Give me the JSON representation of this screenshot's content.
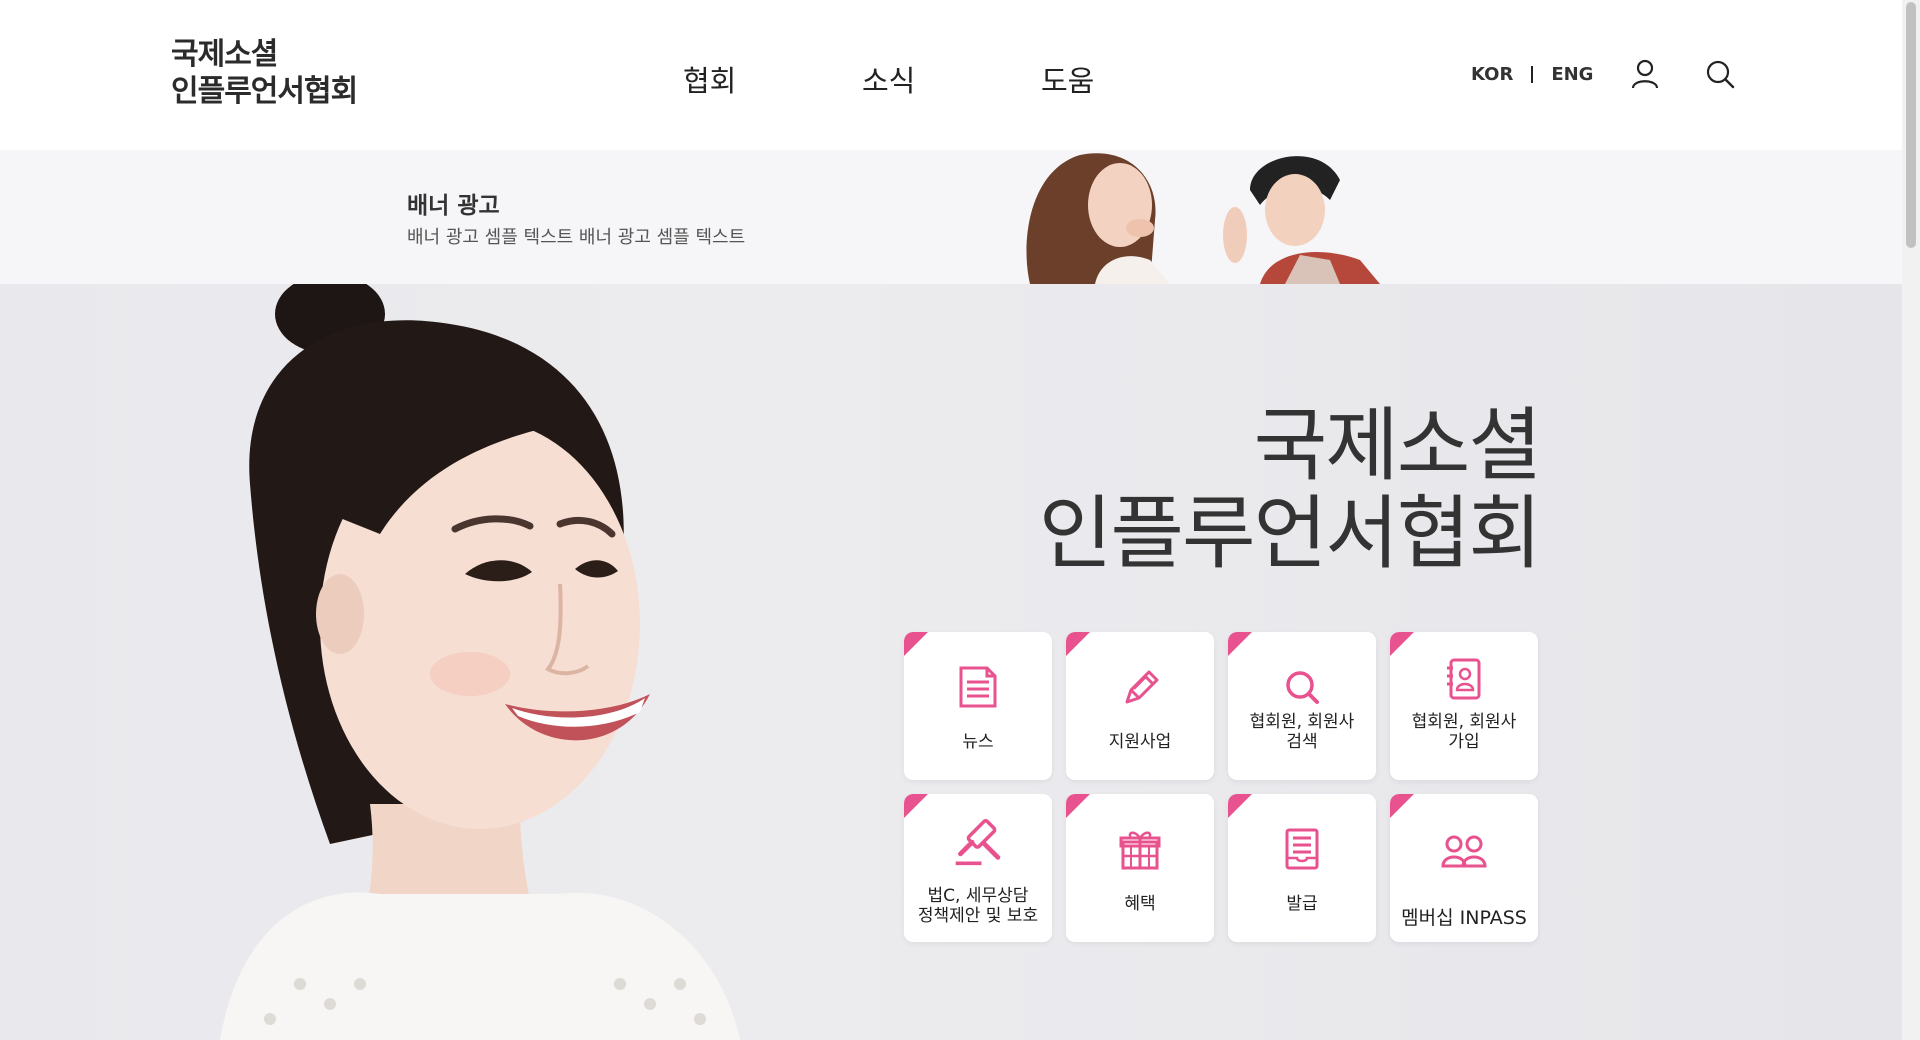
{
  "header": {
    "logo_line1": "국제소셜",
    "logo_line2": "인플루언서협회",
    "nav": [
      {
        "label": "협회"
      },
      {
        "label": "소식"
      },
      {
        "label": "도움"
      }
    ],
    "lang_kor": "KOR",
    "lang_eng": "ENG"
  },
  "banner": {
    "title": "배너 광고",
    "text": "배너 광고 셈플 텍스트 배너 광고 셈플 텍스트"
  },
  "hero": {
    "title_line1": "국제소셜",
    "title_line2": "인플루언서협회"
  },
  "quick_menu": [
    {
      "label": "뉴스",
      "icon": "news-document-icon"
    },
    {
      "label": "지원사업",
      "icon": "pencil-icon"
    },
    {
      "label": "협회원, 회원사\n검색",
      "icon": "search-icon"
    },
    {
      "label": "협회원, 회원사\n가입",
      "icon": "member-notebook-icon"
    },
    {
      "label": "법C, 세무상담\n정책제안 및 보호",
      "icon": "gavel-icon"
    },
    {
      "label": "혜택",
      "icon": "gift-icon"
    },
    {
      "label": "발급",
      "icon": "certificate-icon"
    },
    {
      "label": "멤버십 INPASS",
      "icon": "users-icon"
    }
  ],
  "colors": {
    "accent": "#e8528e",
    "hero_bg": "#e9e9ed",
    "banner_bg": "#f6f6f8"
  }
}
